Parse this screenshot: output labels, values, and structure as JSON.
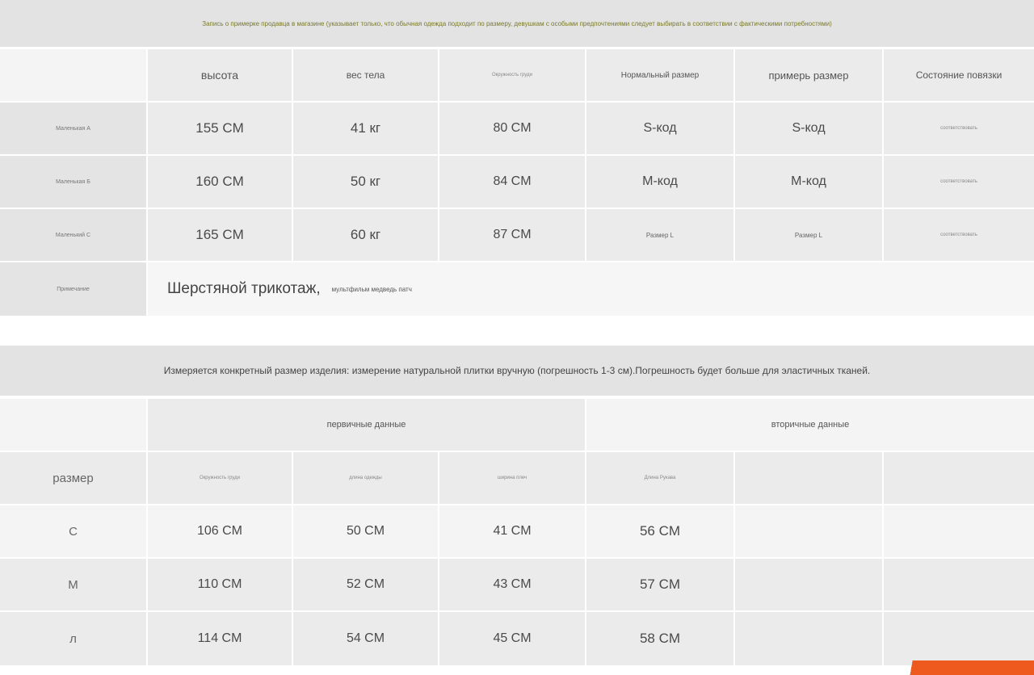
{
  "top_table": {
    "banner": "Запись о примерке продавца в магазине (указывает только, что обычная одежда подходит по размеру, девушкам с особыми предпочтениями следует выбирать в соответствии с фактическими потребностями)",
    "headers": [
      "высота",
      "вес тела",
      "Окружность груди",
      "Нормальный размер",
      "примерь размер",
      "Состояние повязки"
    ],
    "rows": [
      {
        "label": "Маленькая А",
        "height": "155 CM",
        "weight": "41 кг",
        "chest": "80 CM",
        "normal": "S-код",
        "try": "S-код",
        "fit": "соответствовать"
      },
      {
        "label": "Маленькая Б",
        "height": "160 CM",
        "weight": "50 кг",
        "chest": "84 CM",
        "normal": "М-код",
        "try": "М-код",
        "fit": "соответствовать"
      },
      {
        "label": "Маленький С",
        "height": "165 CM",
        "weight": "60 кг",
        "chest": "87 CM",
        "normal": "Размер L",
        "try": "Размер L",
        "fit": "соответствовать"
      }
    ],
    "note_label": "Примечание",
    "note_main": "Шерстяной трикотаж,",
    "note_sub": "мультфильм медведь патч"
  },
  "bottom_table": {
    "banner": "Измеряется конкретный размер изделия: измерение натуральной плитки вручную (погрешность 1-3 см).Погрешность будет больше для эластичных тканей.",
    "group_primary": "первичные данные",
    "group_secondary": "вторичные данные",
    "size_label": "размер",
    "headers": [
      "Окружность груди",
      "длина одежды",
      "ширина плеч",
      "Длина Рукава"
    ],
    "rows": [
      {
        "size": "С",
        "chest": "106 CM",
        "length": "50 CM",
        "shoulder": "41 CM",
        "sleeve": "56 CM"
      },
      {
        "size": "М",
        "chest": "110 CM",
        "length": "52 CM",
        "shoulder": "43 CM",
        "sleeve": "57 CM"
      },
      {
        "size": "л",
        "chest": "114 CM",
        "length": "54 CM",
        "shoulder": "45 CM",
        "sleeve": "58 CM"
      }
    ]
  },
  "colors": {
    "accent": "#ee5a1e",
    "cell": "#ebebeb",
    "banner": "#e3e3e3"
  }
}
